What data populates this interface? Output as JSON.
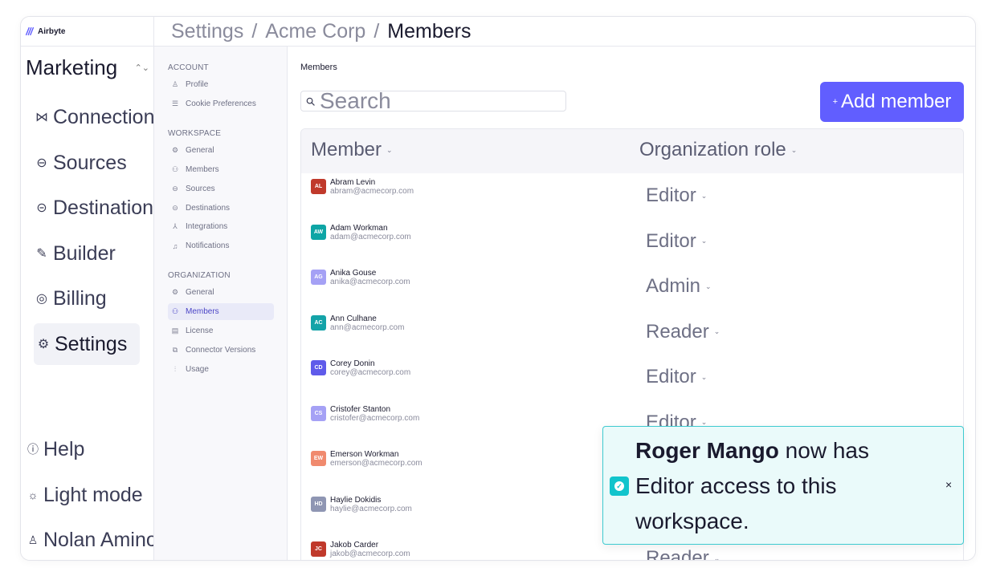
{
  "app": {
    "name": "Airbyte"
  },
  "workspace": {
    "name": "Marketing"
  },
  "breadcrumb": {
    "items": [
      "Settings",
      "Acme Corp"
    ],
    "current": "Members"
  },
  "sidebar": {
    "items": [
      {
        "label": "Connections",
        "icon": "connections-icon"
      },
      {
        "label": "Sources",
        "icon": "sources-icon"
      },
      {
        "label": "Destinations",
        "icon": "destinations-icon"
      },
      {
        "label": "Builder",
        "icon": "builder-icon"
      },
      {
        "label": "Billing",
        "icon": "billing-icon"
      },
      {
        "label": "Settings",
        "icon": "gear-icon",
        "active": true
      }
    ],
    "bottom": [
      {
        "label": "Help",
        "icon": "help-icon"
      },
      {
        "label": "Light mode",
        "icon": "sun-icon"
      },
      {
        "label": "Nolan Aminoff",
        "icon": "user-icon"
      }
    ]
  },
  "settings_nav": {
    "account": {
      "title": "ACCOUNT",
      "items": [
        "Profile",
        "Cookie Preferences"
      ]
    },
    "workspace": {
      "title": "WORKSPACE",
      "items": [
        "General",
        "Members",
        "Sources",
        "Destinations",
        "Integrations",
        "Notifications"
      ]
    },
    "organization": {
      "title": "ORGANIZATION",
      "items": [
        "General",
        "Members",
        "License",
        "Connector Versions",
        "Usage"
      ],
      "active": "Members"
    }
  },
  "main": {
    "title": "Members",
    "search_placeholder": "Search",
    "add_button": "Add member",
    "columns": [
      "Member",
      "Organization role"
    ],
    "members": [
      {
        "initials": "AL",
        "name": "Abram Levin",
        "email": "abram@acmecorp.com",
        "role": "Editor",
        "color": "#c0392b"
      },
      {
        "initials": "AW",
        "name": "Adam Workman",
        "email": "adam@acmecorp.com",
        "role": "Editor",
        "color": "#0ea5a5"
      },
      {
        "initials": "AG",
        "name": "Anika Gouse",
        "email": "anika@acmecorp.com",
        "role": "Admin",
        "color": "#a5a1f5"
      },
      {
        "initials": "AC",
        "name": "Ann Culhane",
        "email": "ann@acmecorp.com",
        "role": "Reader",
        "color": "#14a3a8"
      },
      {
        "initials": "CD",
        "name": "Corey Donin",
        "email": "corey@acmecorp.com",
        "role": "Editor",
        "color": "#5f5bea"
      },
      {
        "initials": "CS",
        "name": "Cristofer Stanton",
        "email": "cristofer@acmecorp.com",
        "role": "Editor",
        "color": "#a5a1f5"
      },
      {
        "initials": "EW",
        "name": "Emerson Workman",
        "email": "emerson@acmecorp.com",
        "role": "",
        "color": "#f08a6e"
      },
      {
        "initials": "HD",
        "name": "Haylie Dokidis",
        "email": "haylie@acmecorp.com",
        "role": "",
        "color": "#8f96b3"
      },
      {
        "initials": "JC",
        "name": "Jakob Carder",
        "email": "jakob@acmecorp.com",
        "role": "Reader",
        "color": "#c0392b"
      }
    ]
  },
  "toast": {
    "name": "Roger Mango",
    "message": " now has Editor access to this workspace.",
    "close": "×"
  }
}
